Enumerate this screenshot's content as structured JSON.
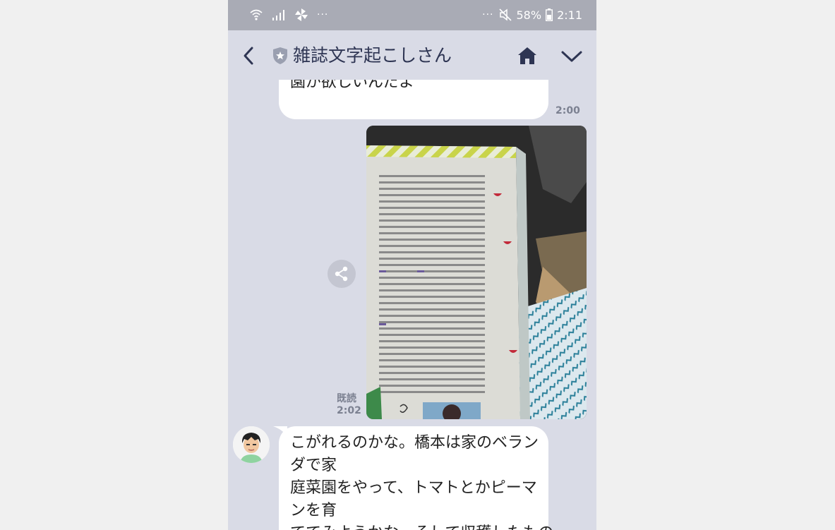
{
  "status_bar": {
    "left_dots": "···",
    "right_dots": "···",
    "battery": "58%",
    "time": "2:11"
  },
  "header": {
    "title": "雑誌文字起こしさん"
  },
  "messages": {
    "m1": {
      "text": "園が欲しいんだよ",
      "time": "2:00"
    },
    "photo": {
      "read_label": "既読",
      "time": "2:02"
    },
    "m2": {
      "lines": [
        "こがれるのかな。橋本は家のベラン",
        "ダで家",
        "庭菜園をやって、トマトとかピーマ",
        "ンを育",
        "ててみようかな。そして収穫したもの"
      ]
    }
  },
  "colors": {
    "chat_bg": "#d9dbe6",
    "status_bg": "#a9abb5",
    "title_color": "#2e3553",
    "bubble_bg": "#ffffff"
  }
}
